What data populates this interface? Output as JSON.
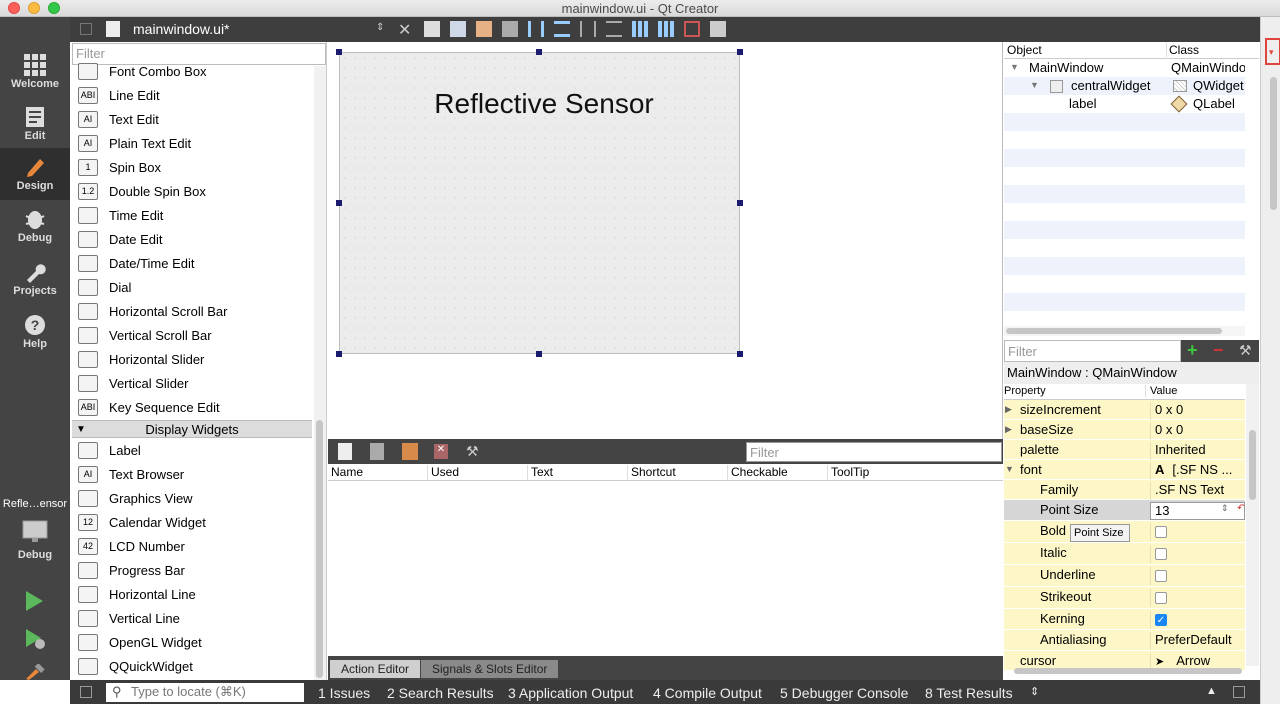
{
  "window": {
    "title": "mainwindow.ui - Qt Creator"
  },
  "modes": [
    {
      "label": "Welcome"
    },
    {
      "label": "Edit"
    },
    {
      "label": "Design"
    },
    {
      "label": "Debug"
    },
    {
      "label": "Projects"
    },
    {
      "label": "Help"
    }
  ],
  "kit": {
    "project": "Refle…ensor",
    "config": "Debug"
  },
  "editor": {
    "filename": "mainwindow.ui*"
  },
  "widgetbox": {
    "filter_placeholder": "Filter",
    "input_items": [
      {
        "label": "Font Combo Box",
        "icon": "font-combo-box-icon"
      },
      {
        "label": "Line Edit",
        "icon": "line-edit-icon"
      },
      {
        "label": "Text Edit",
        "icon": "text-edit-icon"
      },
      {
        "label": "Plain Text Edit",
        "icon": "plain-text-edit-icon"
      },
      {
        "label": "Spin Box",
        "icon": "spin-box-icon"
      },
      {
        "label": "Double Spin Box",
        "icon": "double-spin-box-icon"
      },
      {
        "label": "Time Edit",
        "icon": "time-edit-icon"
      },
      {
        "label": "Date Edit",
        "icon": "date-edit-icon"
      },
      {
        "label": "Date/Time Edit",
        "icon": "datetime-edit-icon"
      },
      {
        "label": "Dial",
        "icon": "dial-icon"
      },
      {
        "label": "Horizontal Scroll Bar",
        "icon": "horizontal-scroll-bar-icon"
      },
      {
        "label": "Vertical Scroll Bar",
        "icon": "vertical-scroll-bar-icon"
      },
      {
        "label": "Horizontal Slider",
        "icon": "horizontal-slider-icon"
      },
      {
        "label": "Vertical Slider",
        "icon": "vertical-slider-icon"
      },
      {
        "label": "Key Sequence Edit",
        "icon": "key-sequence-edit-icon"
      }
    ],
    "display_category": "Display Widgets",
    "display_items": [
      {
        "label": "Label",
        "icon": "label-icon"
      },
      {
        "label": "Text Browser",
        "icon": "text-browser-icon"
      },
      {
        "label": "Graphics View",
        "icon": "graphics-view-icon"
      },
      {
        "label": "Calendar Widget",
        "icon": "calendar-widget-icon"
      },
      {
        "label": "LCD Number",
        "icon": "lcd-number-icon"
      },
      {
        "label": "Progress Bar",
        "icon": "progress-bar-icon"
      },
      {
        "label": "Horizontal Line",
        "icon": "horizontal-line-icon"
      },
      {
        "label": "Vertical Line",
        "icon": "vertical-line-icon"
      },
      {
        "label": "OpenGL Widget",
        "icon": "opengl-widget-icon"
      },
      {
        "label": "QQuickWidget",
        "icon": "qquickwidget-icon"
      }
    ]
  },
  "form": {
    "label_text": "Reflective Sensor"
  },
  "action_editor": {
    "filter_placeholder": "Filter",
    "columns": [
      "Name",
      "Used",
      "Text",
      "Shortcut",
      "Checkable",
      "ToolTip"
    ],
    "tabs": [
      "Action Editor",
      "Signals & Slots Editor"
    ]
  },
  "object_inspector": {
    "headers": [
      "Object",
      "Class"
    ],
    "rows": [
      {
        "object": "MainWindow",
        "class": "QMainWindow"
      },
      {
        "object": "centralWidget",
        "class": "QWidget"
      },
      {
        "object": "label",
        "class": "QLabel"
      }
    ]
  },
  "property_editor": {
    "filter_placeholder": "Filter",
    "title": "MainWindow : QMainWindow",
    "headers": [
      "Property",
      "Value"
    ],
    "rows": [
      {
        "name": "sizeIncrement",
        "value": "0 x 0"
      },
      {
        "name": "baseSize",
        "value": "0 x 0"
      },
      {
        "name": "palette",
        "value": "Inherited"
      },
      {
        "name": "font",
        "value": "[.SF NS ...",
        "glyph": "A"
      },
      {
        "name": "Family",
        "value": ".SF NS Text"
      },
      {
        "name": "Point Size",
        "value": "13"
      },
      {
        "name": "Bold",
        "value": "",
        "checked": false
      },
      {
        "name": "Italic",
        "value": "",
        "checked": false
      },
      {
        "name": "Underline",
        "value": "",
        "checked": false
      },
      {
        "name": "Strikeout",
        "value": "",
        "checked": false
      },
      {
        "name": "Kerning",
        "value": "",
        "checked": true
      },
      {
        "name": "Antialiasing",
        "value": "PreferDefault"
      },
      {
        "name": "cursor",
        "value": "Arrow"
      }
    ],
    "tooltip": "Point Size"
  },
  "statusbar": {
    "locate_placeholder": "Type to locate (⌘K)",
    "panes": [
      "1  Issues",
      "2  Search Results",
      "3  Application Output",
      "4  Compile Output",
      "5  Debugger Console",
      "8  Test Results"
    ]
  },
  "colors": {
    "accent_red": "#e0443e",
    "sidebar": "#444444",
    "property_bg": "#fdf6c6",
    "checkbox_on": "#1b86f5"
  }
}
